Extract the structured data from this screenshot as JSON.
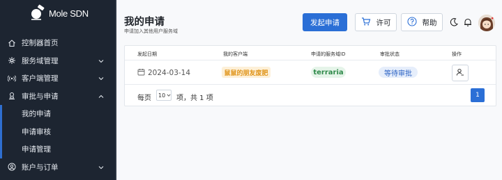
{
  "app": {
    "name": "Mole SDN"
  },
  "sidebar": {
    "items": [
      {
        "label": "控制器首页",
        "icon": "home-icon",
        "expandable": false
      },
      {
        "label": "服务域管理",
        "icon": "network-icon",
        "expandable": true
      },
      {
        "label": "客户端管理",
        "icon": "broadcast-icon",
        "expandable": true
      },
      {
        "label": "审批与申请",
        "icon": "approval-icon",
        "expandable": true,
        "expanded": true
      },
      {
        "label": "账户与订单",
        "icon": "account-icon",
        "expandable": true
      }
    ],
    "sub_items": [
      "我的申请",
      "申请审核",
      "申请管理"
    ]
  },
  "header": {
    "title": "我的申请",
    "subtitle": "申请加入其他用户服务域",
    "new_request_label": "发起申请",
    "license_label": "许可",
    "help_label": "帮助"
  },
  "table": {
    "columns": [
      "发起日期",
      "我的客户端",
      "申请的服务域ID",
      "审批状态",
      "操作"
    ],
    "rows": [
      {
        "date": "2024-03-14",
        "client": "鼠鼠的朋友废肥",
        "domain": "terraria",
        "status": "等待审批"
      }
    ]
  },
  "pagination": {
    "per_page_label": "每页",
    "per_page_value": "10",
    "summary": "项，共 1 项",
    "current_page": "1"
  },
  "colors": {
    "sidebar_bg": "#1d2531",
    "primary": "#2b6fd6",
    "client_tag": "#e0951b",
    "domain_tag": "#2f8a4a",
    "status_tag": "#2b62c4"
  }
}
